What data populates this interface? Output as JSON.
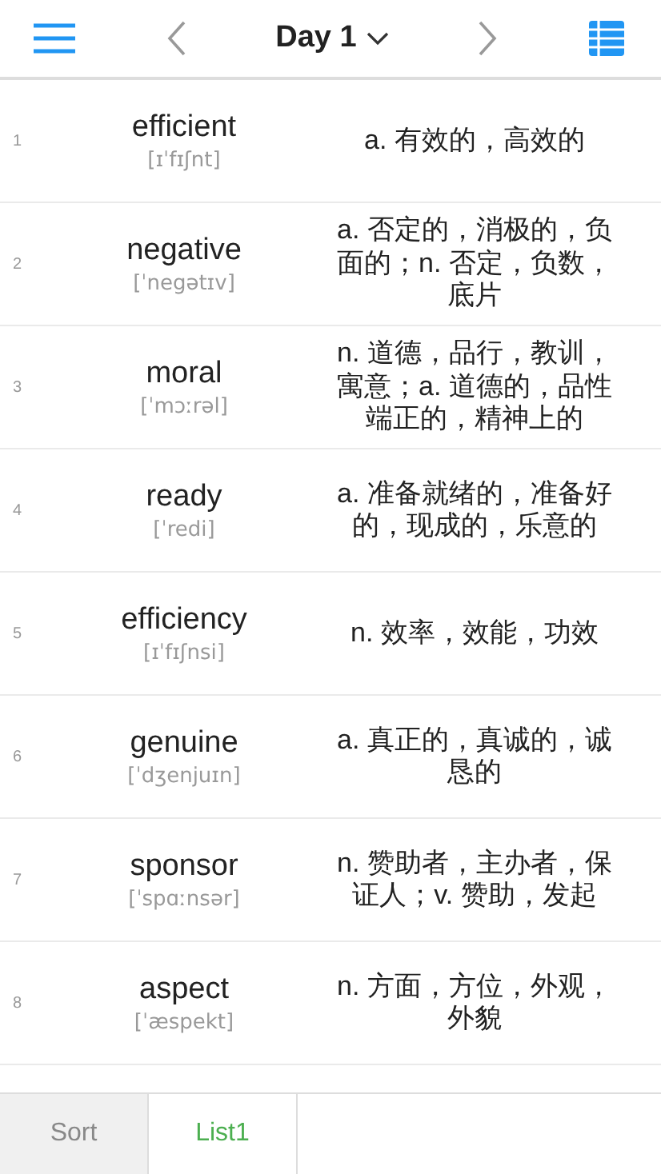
{
  "header": {
    "title": "Day 1"
  },
  "words": [
    {
      "number": "1",
      "word": "efficient",
      "phonetic": "[ɪˈfɪʃnt]",
      "meaning": "a. 有效的，高效的"
    },
    {
      "number": "2",
      "word": "negative",
      "phonetic": "[ˈnegətɪv]",
      "meaning": "a. 否定的，消极的，负面的；n. 否定，负数，底片"
    },
    {
      "number": "3",
      "word": "moral",
      "phonetic": "[ˈmɔːrəl]",
      "meaning": "n. 道德，品行，教训，寓意；a. 道德的，品性端正的，精神上的"
    },
    {
      "number": "4",
      "word": "ready",
      "phonetic": "[ˈredi]",
      "meaning": "a. 准备就绪的，准备好的，现成的，乐意的"
    },
    {
      "number": "5",
      "word": "efficiency",
      "phonetic": "[ɪˈfɪʃnsi]",
      "meaning": "n. 效率，效能，功效"
    },
    {
      "number": "6",
      "word": "genuine",
      "phonetic": "[ˈdʒenjuɪn]",
      "meaning": "a. 真正的，真诚的，诚恳的"
    },
    {
      "number": "7",
      "word": "sponsor",
      "phonetic": "[ˈspɑːnsər]",
      "meaning": "n. 赞助者，主办者，保证人；v. 赞助，发起"
    },
    {
      "number": "8",
      "word": "aspect",
      "phonetic": "[ˈæspekt]",
      "meaning": "n. 方面，方位，外观，外貌"
    }
  ],
  "tabs": [
    {
      "label": "Sort",
      "selected": false
    },
    {
      "label": "List1",
      "selected": true
    }
  ]
}
